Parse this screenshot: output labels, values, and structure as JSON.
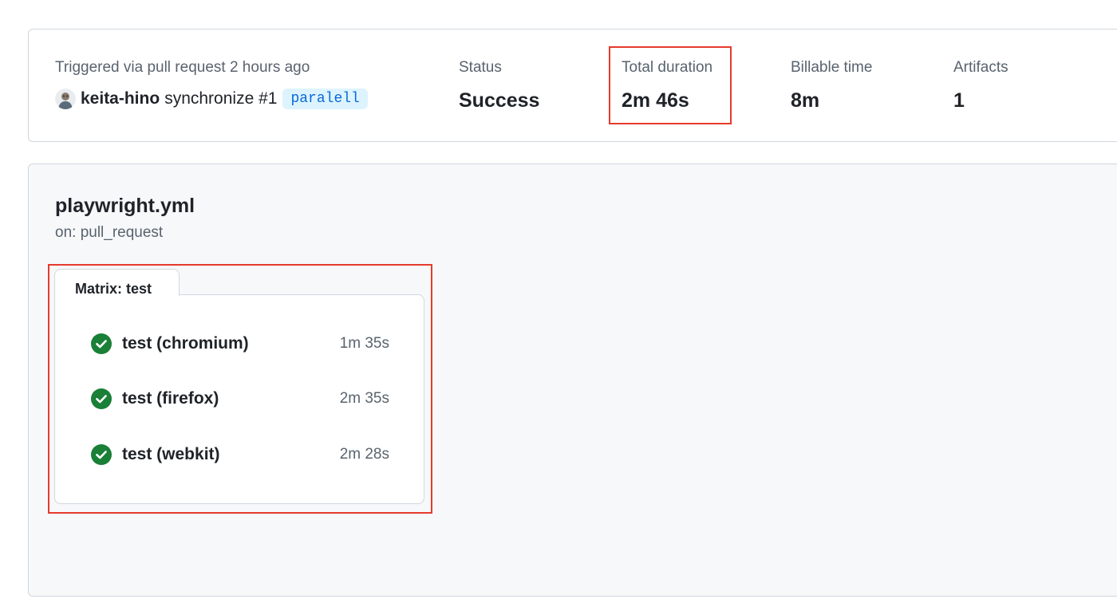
{
  "summary": {
    "trigger_text": "Triggered via pull request 2 hours ago",
    "actor": "keita-hino",
    "event": "synchronize #1",
    "branch": "paralell",
    "status_label": "Status",
    "status_value": "Success",
    "duration_label": "Total duration",
    "duration_value": "2m 46s",
    "billable_label": "Billable time",
    "billable_value": "8m",
    "artifacts_label": "Artifacts",
    "artifacts_value": "1"
  },
  "workflow": {
    "title": "playwright.yml",
    "trigger": "on: pull_request",
    "matrix_label": "Matrix: test",
    "jobs": [
      {
        "name": "test (chromium)",
        "duration": "1m 35s",
        "status": "success",
        "icon": "check-circle-icon"
      },
      {
        "name": "test (firefox)",
        "duration": "2m 35s",
        "status": "success",
        "icon": "check-circle-icon"
      },
      {
        "name": "test (webkit)",
        "duration": "2m 28s",
        "status": "success",
        "icon": "check-circle-icon"
      }
    ]
  },
  "colors": {
    "success": "#1a7f37",
    "link": "#0969da",
    "badge_bg": "#ddf4ff",
    "highlight": "#e53b2c",
    "panel_bg": "#f6f8fa",
    "border": "#d0d7de"
  }
}
